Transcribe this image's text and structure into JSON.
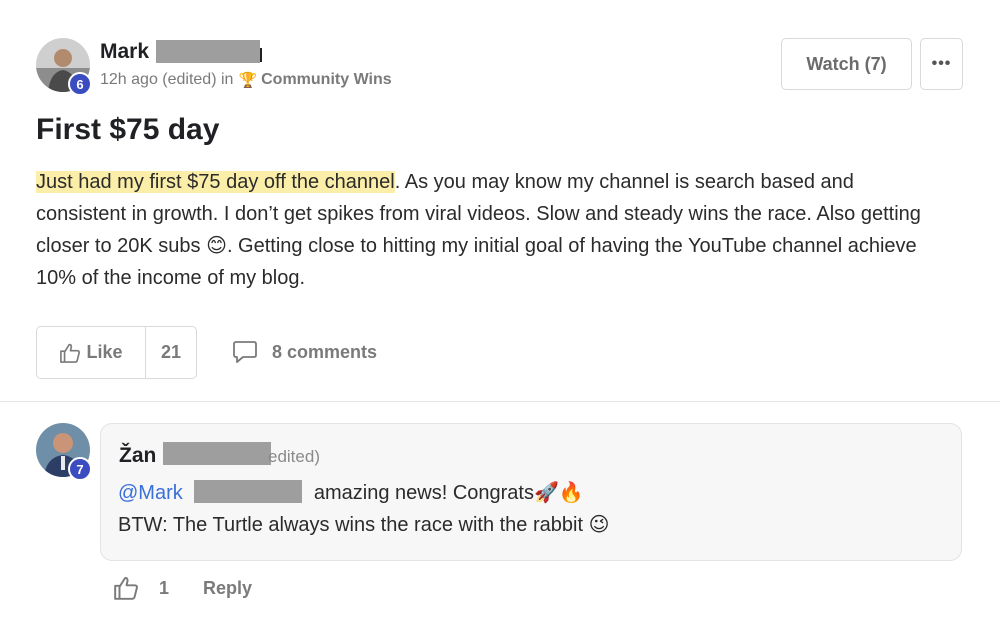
{
  "post": {
    "author": {
      "first_name": "Mark",
      "level": "6"
    },
    "meta": {
      "time": "12h ago (edited) in",
      "category_icon": "trophy-icon",
      "category": "Community Wins"
    },
    "watch_label": "Watch (7)",
    "more_label": "•••",
    "title": "First $75 day",
    "body": {
      "highlighted": "Just had my first $75 day off the channel",
      "rest": ". As you may know my channel is search based and consistent in growth. I don’t get spikes from viral videos. Slow and steady wins the race. Also getting closer to 20K subs 😊. Getting close to hitting my initial goal of having the YouTube channel achieve 10% of the income of my blog."
    },
    "like_label": "Like",
    "like_count": "21",
    "comments_label": "8 comments"
  },
  "comment": {
    "author_first_name": "Žan",
    "level": "7",
    "meta_suffix": "edited)",
    "mention": "@Mark",
    "line1_text": "amazing news! Congrats🚀🔥",
    "line2_text": "BTW: The Turtle always wins the race with the rabbit 😉",
    "like_count": "1",
    "reply_label": "Reply"
  },
  "colors": {
    "accent_badge": "#3b4cc0",
    "mention": "#3a6fd8",
    "highlight": "#fbeea8",
    "redaction": "#9e9e9e"
  }
}
